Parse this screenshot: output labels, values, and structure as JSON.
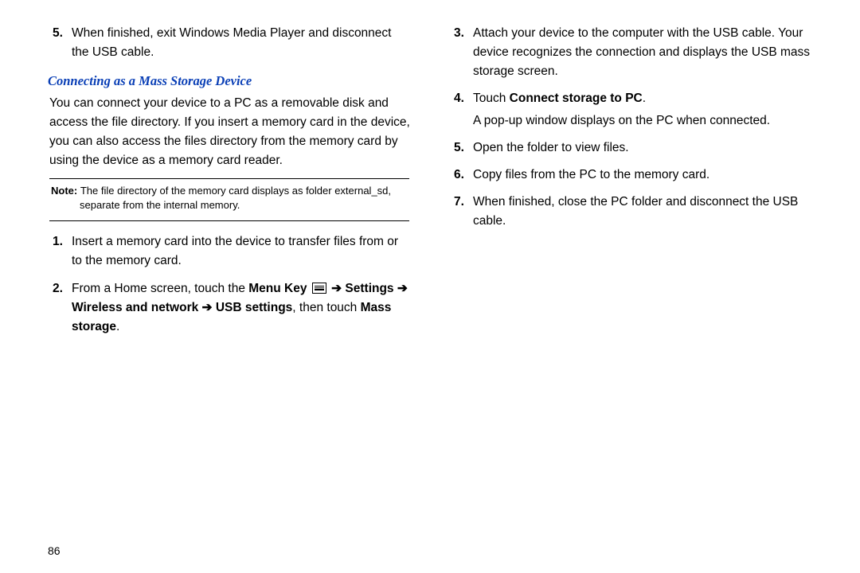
{
  "left": {
    "item5": {
      "num": "5.",
      "text": "When finished, exit Windows Media Player and disconnect the USB cable."
    },
    "heading": "Connecting as a Mass Storage Device",
    "intro": "You can connect your device to a PC as a removable disk and access the file directory. If you insert a memory card in the device, you can also access the files directory from the memory card by using the device as a memory card reader.",
    "note": {
      "label": "Note: ",
      "text": "The file directory of the memory card displays as folder external_sd, separate from the internal memory."
    },
    "item1": {
      "num": "1.",
      "text": "Insert a memory card into the device to transfer files from or to the memory card."
    },
    "item2": {
      "num": "2.",
      "pre": "From a Home screen, touch the ",
      "menuKey": "Menu Key",
      "arrow1": " ➔ ",
      "settings": "Settings",
      "arrow2": " ➔ ",
      "wireless": "Wireless and network",
      "arrow3": " ➔ ",
      "usb": "USB settings",
      "thenTouch": ", then touch ",
      "mass": "Mass storage",
      "dot": "."
    }
  },
  "right": {
    "item3": {
      "num": "3.",
      "text": "Attach your device to the computer with the USB cable. Your device recognizes the connection and displays the USB mass storage screen."
    },
    "item4": {
      "num": "4.",
      "touch": "Touch ",
      "bold": "Connect storage to PC",
      "dot": ".",
      "popup": "A pop-up window displays on the PC when connected."
    },
    "item5": {
      "num": "5.",
      "text": "Open the folder to view files."
    },
    "item6": {
      "num": "6.",
      "text": "Copy files from the PC to the memory card."
    },
    "item7": {
      "num": "7.",
      "text": "When finished, close the PC folder and disconnect the USB cable."
    }
  },
  "pageNum": "86"
}
